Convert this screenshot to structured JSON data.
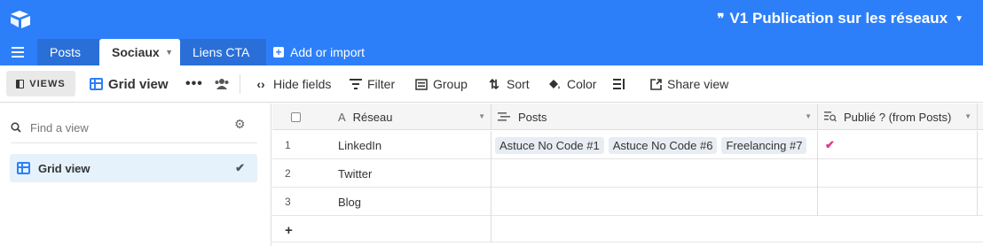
{
  "app": {
    "base_title": "V1 Publication sur les réseaux",
    "colors": {
      "brand_blue": "#2d7ff9",
      "selected_view_bg": "#e5f2fb",
      "checkmark": "#e8318b"
    }
  },
  "tabs": [
    {
      "label": "Posts"
    },
    {
      "label": "Sociaux"
    },
    {
      "label": "Liens CTA"
    }
  ],
  "add_import_label": "Add or import",
  "toolbar": {
    "views_label": "VIEWS",
    "view_name": "Grid view",
    "more_label": "•••",
    "hide_fields": "Hide fields",
    "filter": "Filter",
    "group": "Group",
    "sort": "Sort",
    "color": "Color",
    "share_view": "Share view"
  },
  "sidebar": {
    "search_placeholder": "Find a view",
    "views": [
      {
        "label": "Grid view",
        "selected": true
      }
    ]
  },
  "grid": {
    "columns": [
      {
        "label": "Réseau",
        "icon": "text-field-icon"
      },
      {
        "label": "Posts",
        "icon": "linked-record-icon"
      },
      {
        "label": "Publié ? (from Posts)",
        "icon": "lookup-icon"
      }
    ],
    "rows": [
      {
        "num": "1",
        "reseau": "LinkedIn",
        "posts": [
          "Astuce No Code #1",
          "Astuce No Code #6",
          "Freelancing #7"
        ],
        "publie": "✔"
      },
      {
        "num": "2",
        "reseau": "Twitter",
        "posts": [],
        "publie": ""
      },
      {
        "num": "3",
        "reseau": "Blog",
        "posts": [],
        "publie": ""
      }
    ],
    "add_row_label": "+"
  }
}
